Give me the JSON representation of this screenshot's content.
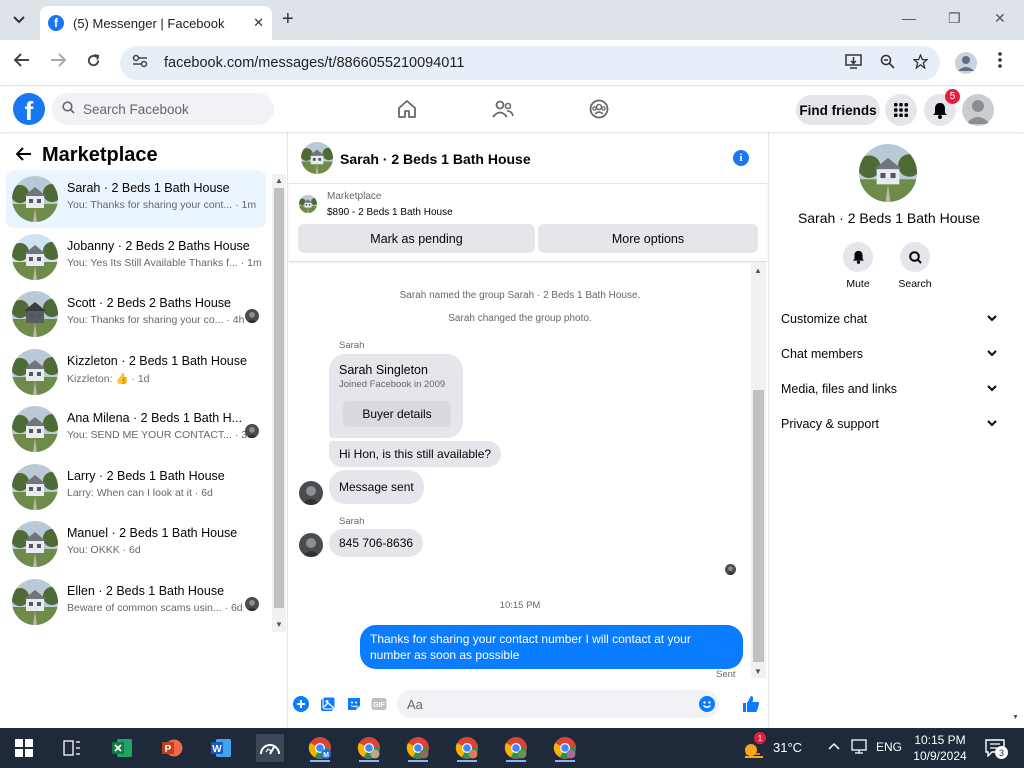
{
  "browser": {
    "tab_title": "(5) Messenger | Facebook",
    "url": "facebook.com/messages/t/8866055210094011",
    "new_tab": "+",
    "close_tab": "✕",
    "minimize": "—",
    "restore": "❐",
    "close_window": "✕"
  },
  "fb_header": {
    "logo": "f",
    "search_placeholder": "Search Facebook",
    "find_friends": "Find friends",
    "notification_count": "5",
    "nav_icons": [
      "home-icon",
      "friends-icon",
      "groups-icon"
    ]
  },
  "left_panel": {
    "title": "Marketplace",
    "conversations": [
      {
        "name": "Sarah · 2 Beds 1 Bath House",
        "snippet": "You: Thanks for sharing your cont... · 1m",
        "active": true
      },
      {
        "name": "Jobanny · 2 Beds 2 Baths House",
        "snippet": "You: Yes Its Still Available Thanks f... · 1m",
        "active": false
      },
      {
        "name": "Scott · 2 Beds 2 Baths House",
        "snippet": "You: Thanks for sharing your co... · 4h",
        "active": false
      },
      {
        "name": "Kizzleton · 2 Beds 1 Bath House",
        "snippet": "Kizzleton: 👍 · 1d",
        "active": false
      },
      {
        "name": "Ana Milena · 2 Beds 1 Bath H...",
        "snippet": "You: SEND ME YOUR CONTACT... · 3d",
        "active": false
      },
      {
        "name": "Larry · 2 Beds 1 Bath House",
        "snippet": "Larry: When can I look at it · 6d",
        "active": false
      },
      {
        "name": "Manuel · 2 Beds 1 Bath House",
        "snippet": "You: OKKK · 6d",
        "active": false
      },
      {
        "name": "Ellen · 2 Beds 1 Bath House",
        "snippet": "Beware of common scams usin... · 6d",
        "active": false
      }
    ]
  },
  "chat": {
    "header_name": "Sarah · 2 Beds 1 Bath House",
    "marketplace_label": "Marketplace",
    "listing": "$890 - 2 Beds 1 Bath House",
    "mark_pending": "Mark as pending",
    "more_options": "More options",
    "system_1": "Sarah named the group Sarah · 2 Beds 1 Bath House.",
    "system_2": "Sarah changed the group photo.",
    "sender_1": "Sarah",
    "card_name": "Sarah Singleton",
    "card_sub": "Joined Facebook in 2009",
    "buyer_details": "Buyer details",
    "msg_1": "Hi Hon, is this still available?",
    "msg_2": "Message sent",
    "sender_2": "Sarah",
    "msg_3": "845 706-8636",
    "timestamp": "10:15 PM",
    "my_msg": "Thanks for sharing your contact number I will contact at your number as soon as possible",
    "sent_label": "Sent",
    "composer_placeholder": "Aa"
  },
  "right_panel": {
    "name": "Sarah · 2 Beds 1 Bath House",
    "mute": "Mute",
    "search": "Search",
    "sections": [
      "Customize chat",
      "Chat members",
      "Media, files and links",
      "Privacy & support"
    ]
  },
  "taskbar": {
    "temperature": "31°C",
    "language": "ENG",
    "time": "10:15 PM",
    "date": "10/9/2024",
    "weather_badge": "1",
    "notif_count": "3"
  },
  "colors": {
    "fb_blue": "#1877f2",
    "messenger_blue": "#0a7cff",
    "badge_red": "#e41e3f"
  }
}
